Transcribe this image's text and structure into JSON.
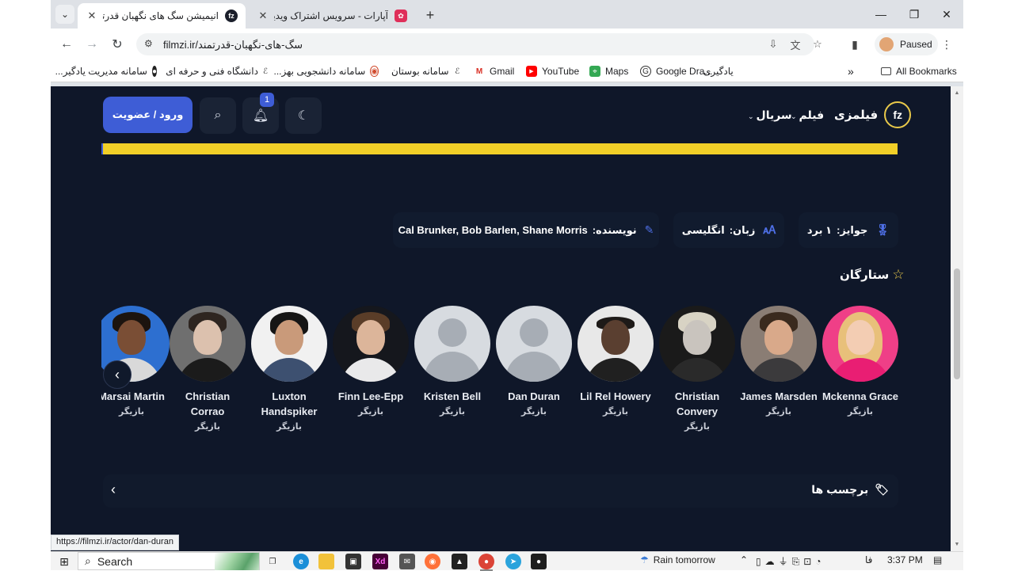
{
  "browser": {
    "tabs": [
      {
        "title": "انیمیشن سگ های نگهبان قدرتمند",
        "active": true,
        "favicon": "fz"
      },
      {
        "title": "آپارات - سرویس اشتراک ویدیو",
        "active": false,
        "favicon": "aparat"
      }
    ],
    "url_host": "filmzi.ir/",
    "url_path": "سگ-های-نگهبان-قدرتمند",
    "profile_label": "Paused",
    "bookmarks": [
      {
        "label": "سامانه مدیریت یادگیر...",
        "icon": "github-icon"
      },
      {
        "label": "دانشگاه فنی و حرفه ای",
        "icon": "university-icon"
      },
      {
        "label": "سامانه دانشجویی بهز...",
        "icon": "student-portal-icon"
      },
      {
        "label": "سامانه بوستان",
        "icon": "bustan-icon"
      },
      {
        "label": "Gmail",
        "icon": "gmail-icon"
      },
      {
        "label": "YouTube",
        "icon": "youtube-icon"
      },
      {
        "label": "Maps",
        "icon": "maps-icon"
      },
      {
        "label": "Google Dra...",
        "icon": "google-drawings-icon"
      },
      {
        "label": "یادگیری",
        "icon": "folder-icon"
      }
    ],
    "all_bookmarks_label": "All Bookmarks",
    "status_url": "https://filmzi.ir/actor/dan-duran"
  },
  "site": {
    "brand_name": "فیلمزی",
    "brand_logo_text": "fz",
    "nav": {
      "film": "فیلم",
      "series": "سریال"
    },
    "login_label": "ورود / عضویت",
    "notification_count": "1"
  },
  "meta": {
    "awards_label": "جوایز:",
    "awards_value": "۱ برد",
    "language_label": "زبان:",
    "language_value": "انگلیسی",
    "writer_label": "نویسنده:",
    "writer_value": "Cal Brunker, Bob Barlen, Shane Morris"
  },
  "stars": {
    "title": "ستارگان",
    "cast": [
      {
        "name": "Mckenna Grace",
        "role": "بازیگر",
        "photo": "real"
      },
      {
        "name": "James Marsden",
        "role": "بازیگر",
        "photo": "real"
      },
      {
        "name": "Christian Convery",
        "role": "بازیگر",
        "photo": "real"
      },
      {
        "name": "Lil Rel Howery",
        "role": "بازیگر",
        "photo": "real"
      },
      {
        "name": "Dan Duran",
        "role": "بازیگر",
        "photo": "placeholder"
      },
      {
        "name": "Kristen Bell",
        "role": "بازیگر",
        "photo": "placeholder"
      },
      {
        "name": "Finn Lee-Epp",
        "role": "بازیگر",
        "photo": "real"
      },
      {
        "name": "Luxton Handspiker",
        "role": "بازیگر",
        "photo": "real"
      },
      {
        "name": "Christian Corrao",
        "role": "بازیگر",
        "photo": "real"
      },
      {
        "name": "Marsai Martin",
        "role": "بازیگر",
        "photo": "real"
      }
    ]
  },
  "tags": {
    "title": "برچسب ها"
  },
  "taskbar": {
    "search_placeholder": "Search",
    "weather": "Rain tomorrow",
    "lang": "فا",
    "time": "3:37 PM"
  },
  "colors": {
    "page_bg": "#0f1729",
    "accent": "#3e5dd6",
    "highlight": "#f1cf28"
  }
}
